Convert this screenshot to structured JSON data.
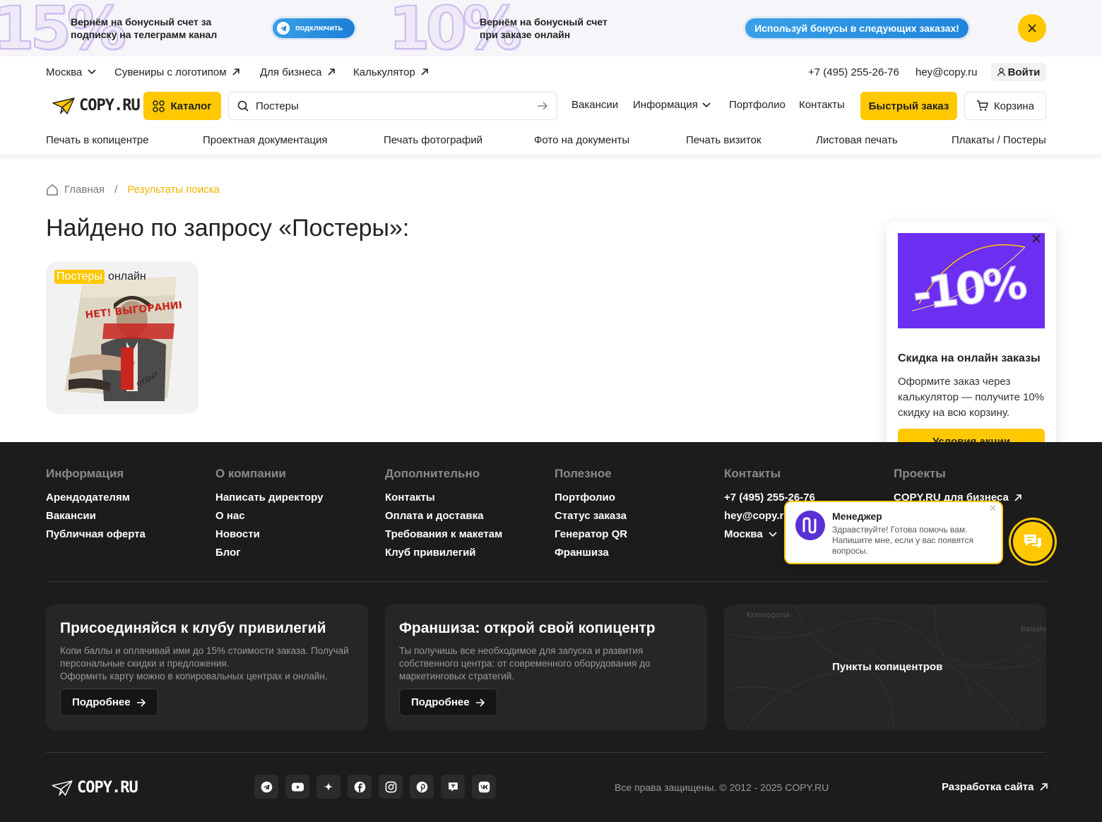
{
  "promo": {
    "left_pct": "15%",
    "left_text": "Вернём на бонусный счет за подписку на телеграмм канал",
    "left_button": "подключить",
    "mid_pct": "10%",
    "mid_text": "Вернём на бонусный счет при заказе онлайн",
    "right_button": "Используй бонусы в следующих заказах!"
  },
  "topbar": {
    "city": "Москва",
    "souvenirs": "Сувениры с логотипом",
    "business": "Для бизнеса",
    "calculator": "Калькулятор",
    "phone": "+7 (495) 255-26-76",
    "email": "hey@copy.ru",
    "login": "Войти"
  },
  "header": {
    "logo": "COPY.RU",
    "catalog": "Каталог",
    "search_value": "Постеры",
    "nav": [
      "Вакансии",
      "Информация",
      "Портфолио",
      "Контакты"
    ],
    "quick_order": "Быстрый заказ",
    "cart": "Корзина"
  },
  "categories": [
    "Печать в копицентре",
    "Проектная документация",
    "Печать фотографий",
    "Фото на документы",
    "Печать визиток",
    "Листовая печать",
    "Плакаты / Постеры"
  ],
  "breadcrumbs": {
    "home": "Главная",
    "separator": "/",
    "current": "Результаты поиска"
  },
  "page_title": "Найдено по запросу «Постеры»:",
  "result": {
    "tag": "Постеры",
    "tag_suffix": "онлайн",
    "poster_head": "НЕТ! ВЫГОРАНИЮ",
    "poster_word": "ОТДЫХ"
  },
  "popup": {
    "badge": "-10%",
    "title": "Скидка на онлайн заказы",
    "text": "Оформите заказ через калькулятор — получите 10% скидку на всю корзину.",
    "button": "Условия акции"
  },
  "footer": {
    "columns": [
      {
        "title": "Информация",
        "links": [
          "Арендодателям",
          "Вакансии",
          "Публичная оферта"
        ]
      },
      {
        "title": "О компании",
        "links": [
          "Написать директору",
          "О нас",
          "Новости",
          "Блог"
        ]
      },
      {
        "title": "Дополнительно",
        "links": [
          "Контакты",
          "Оплата и доставка",
          "Требования к макетам",
          "Клуб привилегий"
        ]
      },
      {
        "title": "Полезное",
        "links": [
          "Портфолио",
          "Статус заказа",
          "Генератор QR",
          "Франшиза"
        ]
      },
      {
        "title": "Контакты",
        "links": [
          "+7 (495) 255-26-76",
          "hey@copy.ru",
          "Москва"
        ]
      },
      {
        "title": "Проекты",
        "links": [
          "COPY.RU для бизнеса"
        ]
      }
    ],
    "club": {
      "title": "Присоединяйся к клубу привилегий",
      "desc": "Копи баллы и оплачивай ими до 15% стоимости заказа. Получай персональные скидки и предложения.",
      "desc2": "Оформить карту можно в копировальных центрах и онлайн.",
      "button": "Подробнее"
    },
    "franchise": {
      "title": "Франшиза: открой свой копицентр",
      "desc": "Ты получишь все необходимое для запуска и развития собственного центра: от современного оборудования до маркетинговых стратегий.",
      "button": "Подробнее"
    },
    "map": {
      "label": "Пункты копицентров",
      "place1": "Krasnogorsk",
      "place2": "Balashikha"
    },
    "logo": "COPY.RU",
    "socials": [
      "telegram-icon",
      "youtube-icon",
      "zen-icon",
      "facebook-icon",
      "instagram-icon",
      "pinterest-icon",
      "tenchat-icon",
      "vk-icon"
    ],
    "copyright": "Все права защищены. © 2012 - 2025 COPY.RU",
    "dev": "Разработка сайта"
  },
  "chat": {
    "name": "Менеджер",
    "message": "Здравствуйте! Готова помочь вам. Напишите мне, если у вас появятся вопросы."
  },
  "colors": {
    "accent": "#ffc800",
    "footer_bg": "#1c1c1c",
    "card_bg": "#262626",
    "telegram_blue": "#1c7fd6",
    "promo_purple": "#6c2ef0"
  }
}
